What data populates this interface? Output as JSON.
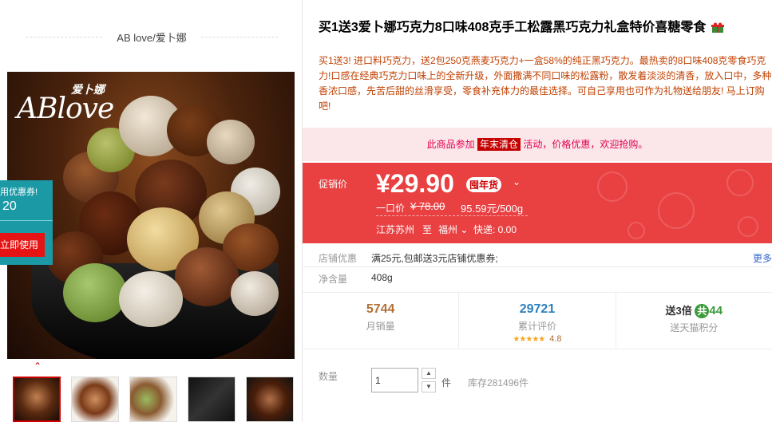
{
  "shop": {
    "name": "AB love/爱卜娜"
  },
  "gallery": {
    "brand_cn": "爱卜娜",
    "brand_en": "ABlove",
    "coupon": {
      "line1": "用优惠券!",
      "amount": "20",
      "button": "立即使用"
    },
    "thumb_count": 5
  },
  "product": {
    "title": "买1送3爱卜娜巧克力8口味408克手工松露黑巧克力礼盒特价喜糖零食",
    "subtitle": "买1送3! 进口料巧克力，送2包250克燕麦巧克力+一盒58%的纯正黑巧克力。最热卖的8口味408克零食巧克力!口感在经典巧克力口味上的全新升级，外面撒满不同口味的松露粉，散发着淡淡的清香，放入口中，多种香浓口感，先苦后甜的丝滑享受，零食补充体力的最佳选择。可自己享用也可作为礼物送给朋友! 马上订购吧!"
  },
  "promo_bar": {
    "prefix": "此商品参加",
    "tag": "年末清仓",
    "suffix": "活动，价格优惠，欢迎抢购。"
  },
  "price": {
    "label": "促销价",
    "value": "¥29.90",
    "badge": "囤年货",
    "old_label": "一口价",
    "old_value": "¥ 78.00",
    "unit_price": "95.59元/500g",
    "ship_from": "江苏苏州",
    "ship_to": "至",
    "ship_city": "福州",
    "ship_fee": "快递: 0.00"
  },
  "shop_promo": {
    "label": "店铺优惠",
    "text": "满25元,包邮送3元店铺优惠券;",
    "more": "更多"
  },
  "net_weight": {
    "label": "净含量",
    "value": "408g"
  },
  "stats": {
    "monthly_sales": "5744",
    "monthly_sales_label": "月销量",
    "reviews": "29721",
    "reviews_label": "累计评价",
    "rating_stars": "★★★★★",
    "rating": "4.8",
    "bonus_prefix": "送3倍",
    "bonus_circle": "共",
    "bonus_value": "44",
    "bonus_label": "送天猫积分"
  },
  "quantity": {
    "label": "数量",
    "value": "1",
    "unit": "件",
    "stock": "库存281496件"
  },
  "colors": {
    "price_bg": "#e94042",
    "promo_bg": "#fbe6ea",
    "promo_text": "#e4004f",
    "accent": "#c40000",
    "link": "#2b7fbf"
  }
}
